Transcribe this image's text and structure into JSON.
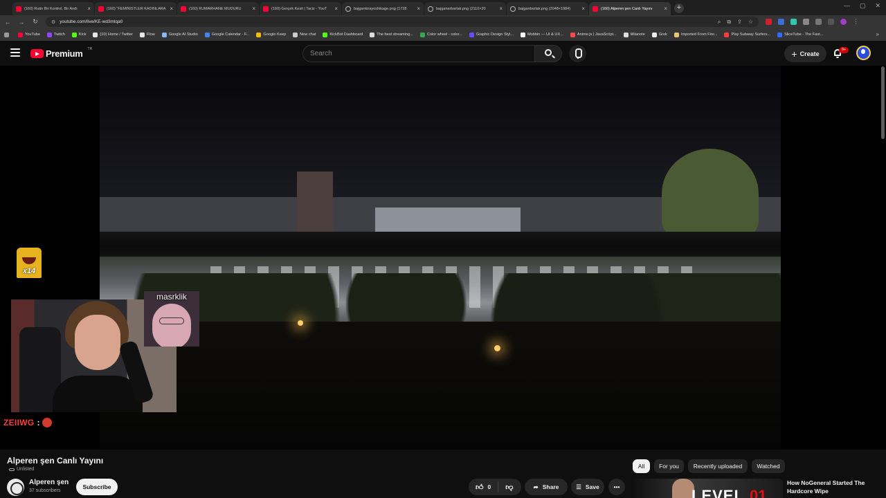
{
  "browser": {
    "tabs": [
      {
        "title": "(160) Rutin Bir Kontrol, Bir Andı",
        "icon": "youtube-icon"
      },
      {
        "title": "(160) \"FEMİNİSTLER KADINLARA",
        "icon": "youtube-icon"
      },
      {
        "title": "(160) KUMARHANE MÜDÜRÜ",
        "icon": "youtube-icon"
      },
      {
        "title": "(160) Gerçek Kesit | Taciz - YouT",
        "icon": "youtube-icon"
      },
      {
        "title": "bajgankirayoshikage.png (1728",
        "icon": "globe-icon"
      },
      {
        "title": "bajganarbarlak.png (2110×20",
        "icon": "globe-icon"
      },
      {
        "title": "bajganbarlak.png (2048×1984)",
        "icon": "globe-icon"
      },
      {
        "title": "(160) Alperen şen Canlı Yayını",
        "icon": "youtube-icon",
        "active": true
      }
    ],
    "url": "youtube.com/live/KE-wd3mlqa0",
    "bookmarks": [
      {
        "label": "YouTube",
        "color": "#ff0033"
      },
      {
        "label": "Twitch",
        "color": "#9146ff"
      },
      {
        "label": "Kick",
        "color": "#53fc18"
      },
      {
        "label": "(10) Home / Twitter",
        "color": "#e7e7e7"
      },
      {
        "label": "Flow",
        "color": "#e8e8e8"
      },
      {
        "label": "Google AI Studio",
        "color": "#8ab4f8"
      },
      {
        "label": "Google Calendar - F...",
        "color": "#4285f4"
      },
      {
        "label": "Google Keep",
        "color": "#fbbc04"
      },
      {
        "label": "New chat",
        "color": "#cccccc"
      },
      {
        "label": "KickBot Dashboard",
        "color": "#53fc18"
      },
      {
        "label": "The best streaming...",
        "color": "#dddddd"
      },
      {
        "label": "Color wheel - color...",
        "color": "#34a853"
      },
      {
        "label": "Graphic Design Styl...",
        "color": "#6a4bff"
      },
      {
        "label": "Mobbin — UI & UX...",
        "color": "#ffffff"
      },
      {
        "label": "Anime.js | JavaScript...",
        "color": "#ff4b4b"
      },
      {
        "label": "Milanote",
        "color": "#dddddd"
      },
      {
        "label": "Grok",
        "color": "#eeeeee"
      },
      {
        "label": "Imported From Fire...",
        "color": "#e8c66a"
      },
      {
        "label": "Play Subway Surfers...",
        "color": "#ff3b3b"
      },
      {
        "label": "SliceTube - The Fast...",
        "color": "#2d6cff"
      }
    ]
  },
  "masthead": {
    "logo_text": "Premium",
    "country_code": "TR",
    "search_placeholder": "Search",
    "create_label": "Create",
    "notification_count": "9+"
  },
  "stream": {
    "emote_text": "x14",
    "guest_name": "masrklik",
    "chat_user": "ZEIIWG",
    "chat_separator": ":"
  },
  "video": {
    "title": "Alperen şen Canlı Yayını",
    "visibility": "Unlisted",
    "channel_name": "Alperen şen",
    "subscribers": "37 subscribers",
    "subscribe_label": "Subscribe",
    "like_count": "0",
    "share_label": "Share",
    "save_label": "Save"
  },
  "related": {
    "chips": [
      "All",
      "For you",
      "Recently uploaded",
      "Watched"
    ],
    "active_chip": "All",
    "first_title": "How NoGeneral Started The Hardcore Wipe",
    "thumb_text_1": "LEVEL",
    "thumb_text_2": "01"
  }
}
